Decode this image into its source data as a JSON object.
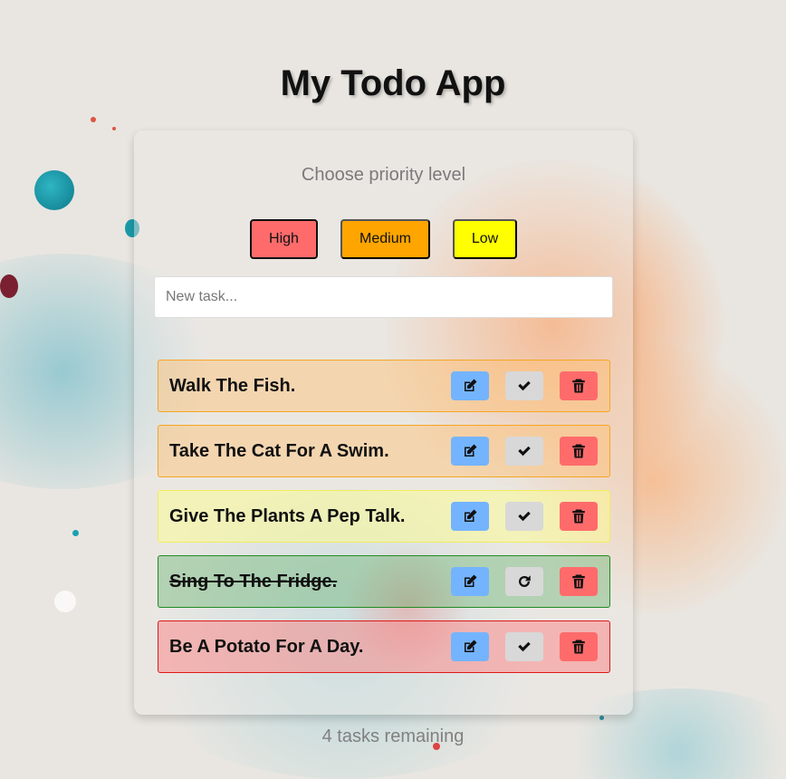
{
  "app": {
    "title": "My Todo App"
  },
  "priority": {
    "label": "Choose priority level",
    "options": [
      {
        "label": "High",
        "color": "#ff6b6b",
        "selected": true
      },
      {
        "label": "Medium",
        "color": "#ffa500",
        "selected": false
      },
      {
        "label": "Low",
        "color": "#ffff00",
        "selected": false
      }
    ]
  },
  "new_task": {
    "placeholder": "New task...",
    "value": ""
  },
  "tasks": [
    {
      "text": "Walk The Fish.",
      "priority": "medium",
      "done": false,
      "status_icon": "check-icon"
    },
    {
      "text": "Take The Cat For A Swim.",
      "priority": "medium",
      "done": false,
      "status_icon": "check-icon"
    },
    {
      "text": "Give The Plants A Pep Talk.",
      "priority": "low",
      "done": false,
      "status_icon": "check-icon"
    },
    {
      "text": "Sing To The Fridge.",
      "priority": "medium",
      "done": true,
      "status_icon": "redo-icon"
    },
    {
      "text": "Be A Potato For A Day.",
      "priority": "high",
      "done": false,
      "status_icon": "check-icon"
    }
  ],
  "footer": {
    "remaining": "4 tasks remaining"
  },
  "colors": {
    "edit": "#74b4ff",
    "complete": "#d8d8d8",
    "delete": "#ff6b6b",
    "done_border": "#228b22"
  }
}
